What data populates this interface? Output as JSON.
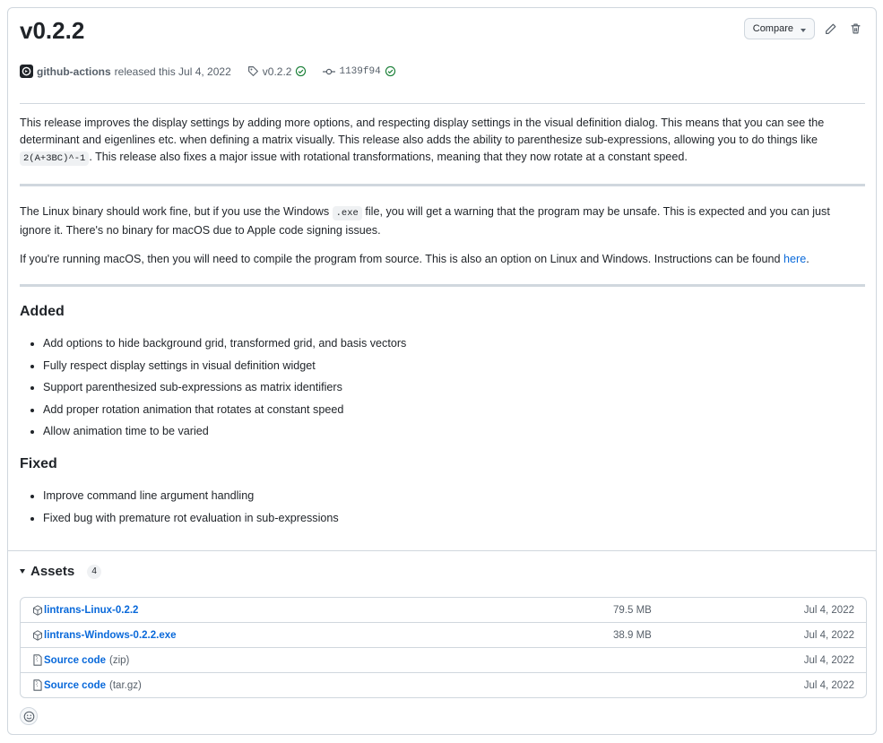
{
  "release": {
    "title": "v0.2.2",
    "compare_label": "Compare",
    "author": "github-actions",
    "released_text": "released this Jul 4, 2022",
    "tag": "v0.2.2",
    "commit": "1139f94"
  },
  "body": {
    "p1_a": "This release improves the display settings by adding more options, and respecting display settings in the visual definition dialog. This means that you can see the determinant and eigenlines etc. when defining a matrix visually. This release also adds the ability to parenthesize sub-expressions, allowing you to do things like ",
    "p1_code": "2(A+3BC)^-1",
    "p1_b": ". This release also fixes a major issue with rotational transformations, meaning that they now rotate at a constant speed.",
    "p2_a": "The Linux binary should work fine, but if you use the Windows ",
    "p2_code": ".exe",
    "p2_b": " file, you will get a warning that the program may be unsafe. This is expected and you can just ignore it. There's no binary for macOS due to Apple code signing issues.",
    "p3_a": "If you're running macOS, then you will need to compile the program from source. This is also an option on Linux and Windows. Instructions can be found ",
    "p3_link": "here",
    "p3_b": "."
  },
  "added": {
    "heading": "Added",
    "items": [
      "Add options to hide background grid, transformed grid, and basis vectors",
      "Fully respect display settings in visual definition widget",
      "Support parenthesized sub-expressions as matrix identifiers",
      "Add proper rotation animation that rotates at constant speed",
      "Allow animation time to be varied"
    ]
  },
  "fixed": {
    "heading": "Fixed",
    "items": [
      "Improve command line argument handling",
      "Fixed bug with premature rot evaluation in sub-expressions"
    ]
  },
  "assets": {
    "heading": "Assets",
    "count": "4",
    "rows": [
      {
        "name": "lintrans-Linux-0.2.2",
        "suffix": "",
        "size": "79.5 MB",
        "date": "Jul 4, 2022",
        "icon": "package-icon"
      },
      {
        "name": "lintrans-Windows-0.2.2.exe",
        "suffix": "",
        "size": "38.9 MB",
        "date": "Jul 4, 2022",
        "icon": "package-icon"
      },
      {
        "name": "Source code",
        "suffix": "(zip)",
        "size": "",
        "date": "Jul 4, 2022",
        "icon": "file-zip-icon"
      },
      {
        "name": "Source code",
        "suffix": "(tar.gz)",
        "size": "",
        "date": "Jul 4, 2022",
        "icon": "file-zip-icon"
      }
    ]
  }
}
